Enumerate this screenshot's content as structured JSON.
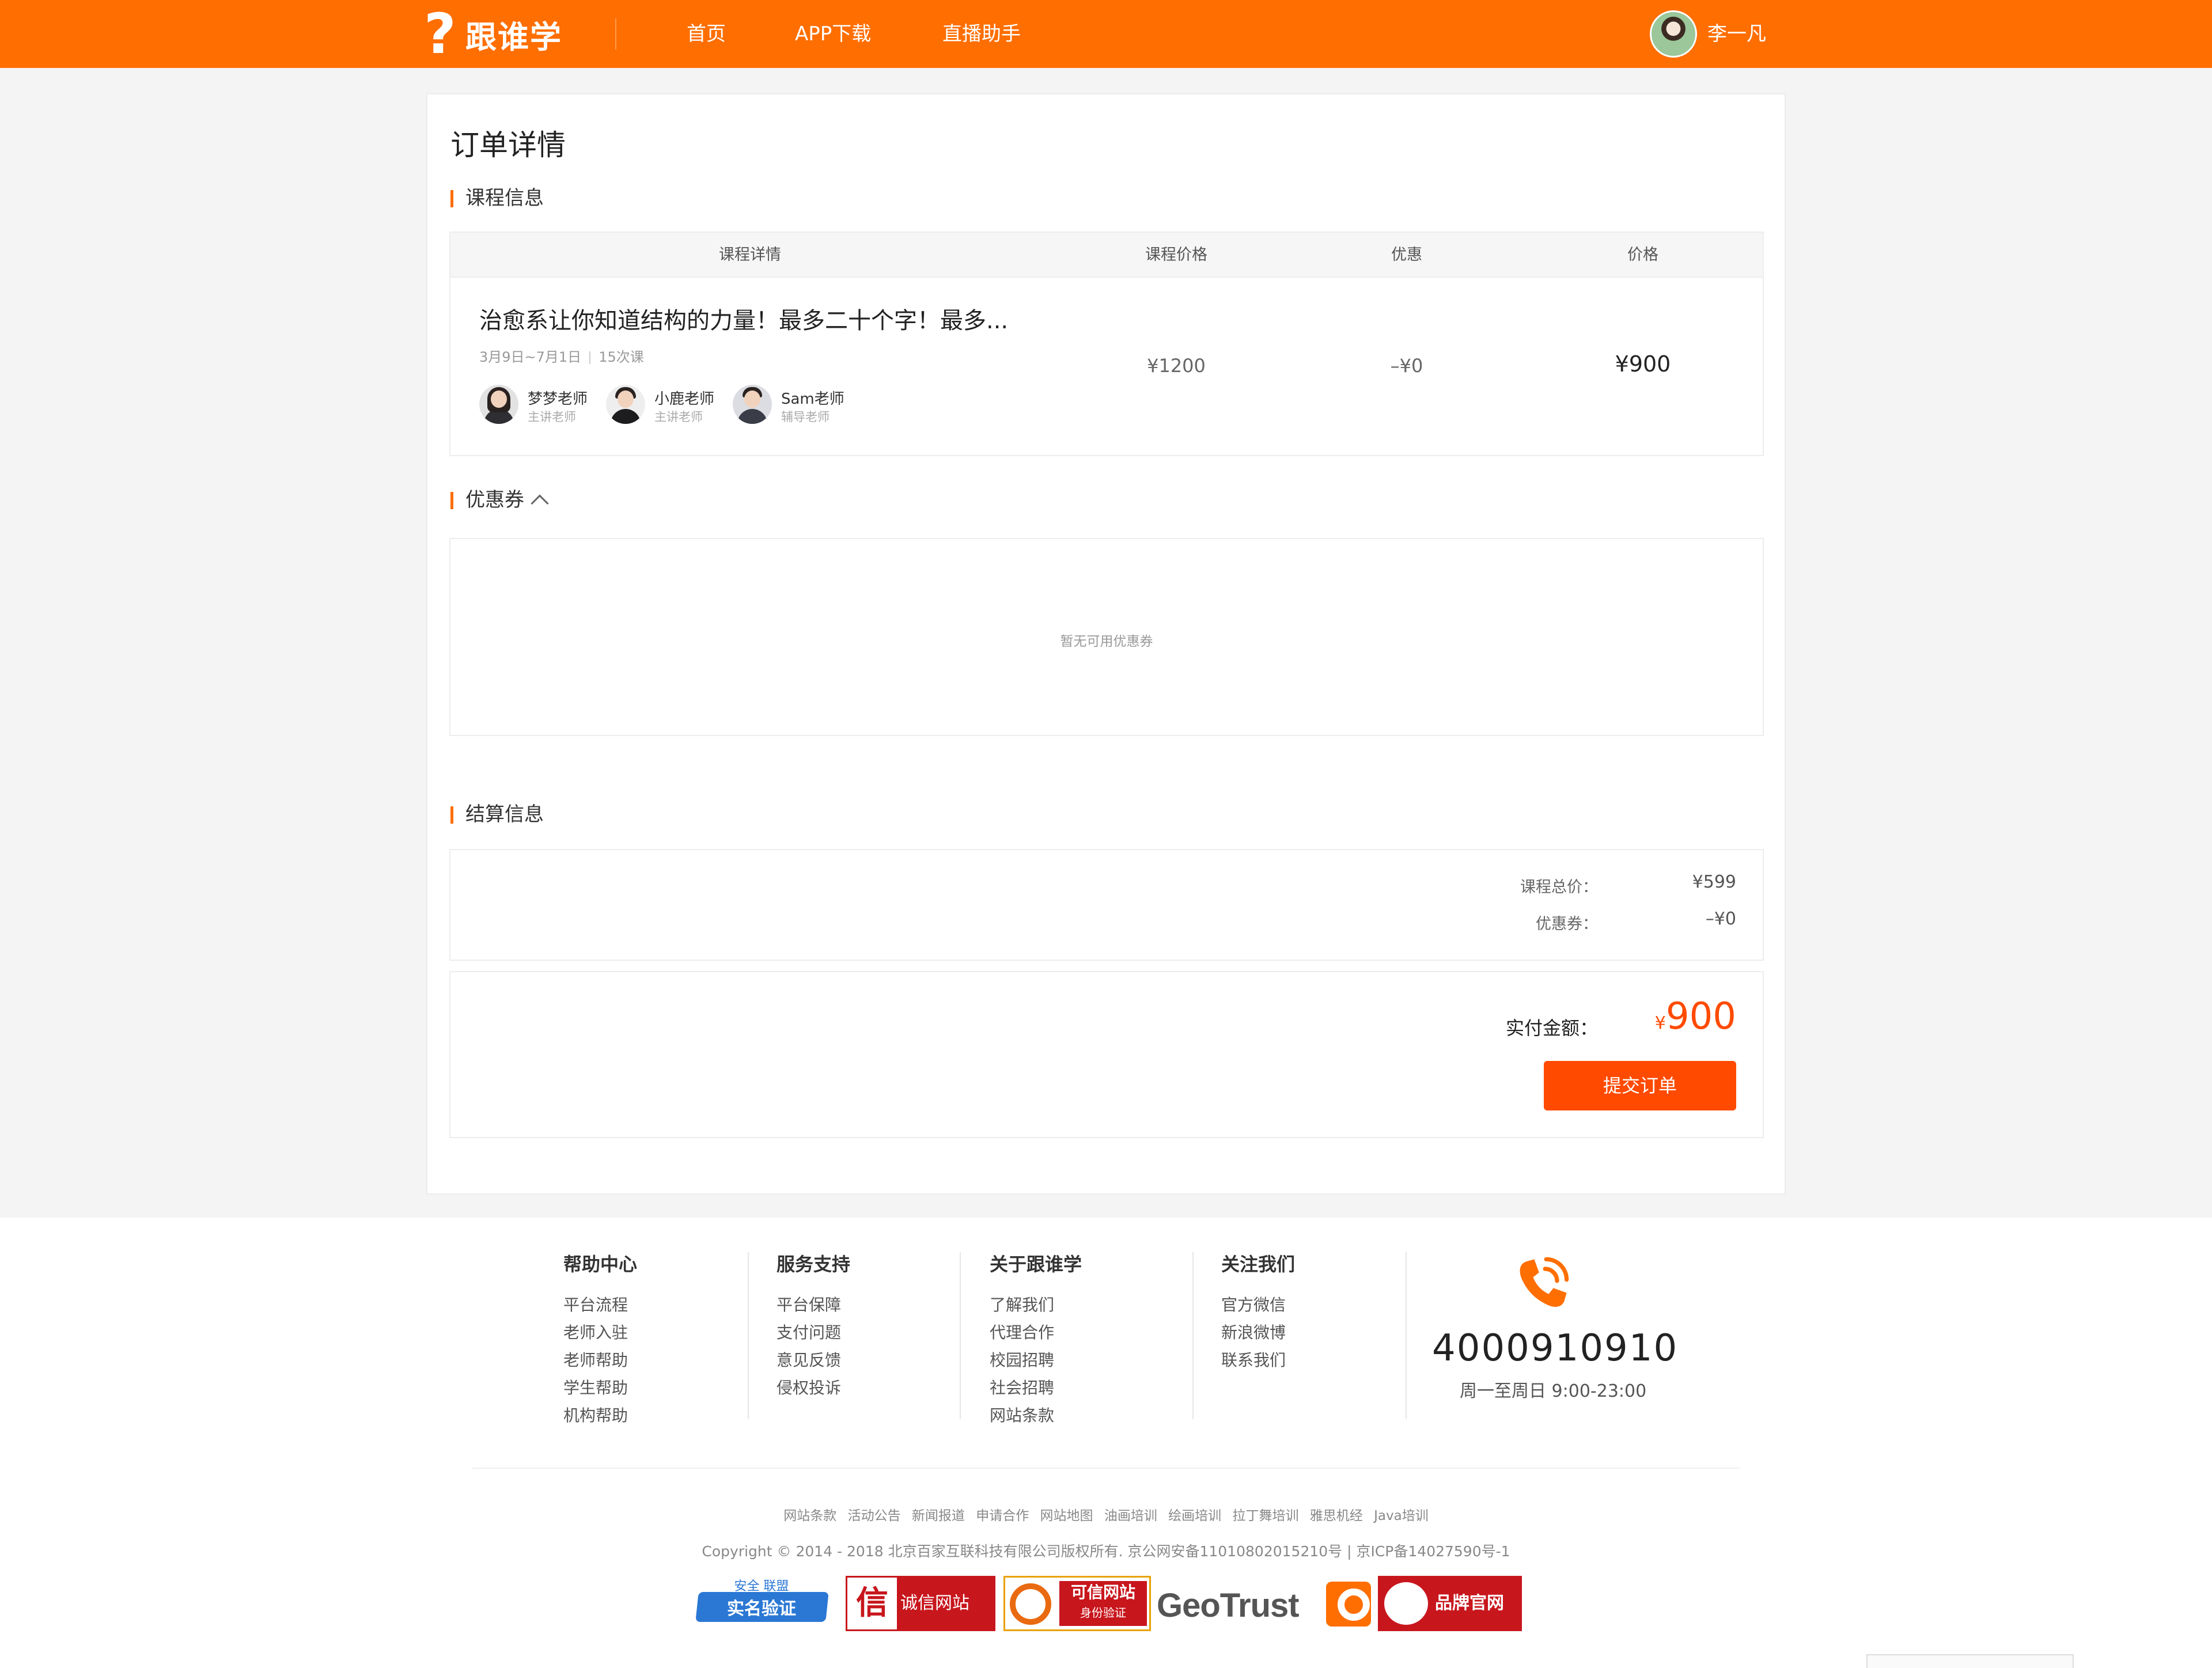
{
  "header": {
    "logo_mark": "?",
    "logo_text": "跟谁学",
    "nav": [
      "首页",
      "APP下载",
      "直播助手"
    ],
    "user_name": "李一凡"
  },
  "page": {
    "title": "订单详情"
  },
  "course_section": {
    "title": "课程信息",
    "columns": [
      "课程详情",
      "课程价格",
      "优惠",
      "价格"
    ],
    "course": {
      "name": "治愈系让你知道结构的力量！最多二十个字！最多...",
      "dates": "3月9日~7月1日",
      "lessons": "15次课",
      "price": "¥1200",
      "discount": "–¥0",
      "final": "¥900"
    },
    "teachers": [
      {
        "name": "梦梦老师",
        "role": "主讲老师"
      },
      {
        "name": "小鹿老师",
        "role": "主讲老师"
      },
      {
        "name": "Sam老师",
        "role": "辅导老师"
      }
    ]
  },
  "coupon_section": {
    "title": "优惠券",
    "empty_text": "暂无可用优惠券"
  },
  "settle_section": {
    "title": "结算信息",
    "rows": [
      {
        "label": "课程总价：",
        "value": "¥599"
      },
      {
        "label": "优惠券：",
        "value": "–¥0"
      }
    ],
    "pay_label": "实付金额：",
    "pay_currency": "¥",
    "pay_amount": "900",
    "submit_label": "提交订单"
  },
  "footer": {
    "columns": [
      {
        "title": "帮助中心",
        "links": [
          "平台流程",
          "老师入驻",
          "老师帮助",
          "学生帮助",
          "机构帮助"
        ]
      },
      {
        "title": "服务支持",
        "links": [
          "平台保障",
          "支付问题",
          "意见反馈",
          "侵权投诉"
        ]
      },
      {
        "title": "关于跟谁学",
        "links": [
          "了解我们",
          "代理合作",
          "校园招聘",
          "社会招聘",
          "网站条款"
        ]
      },
      {
        "title": "关注我们",
        "links": [
          "官方微信",
          "新浪微博",
          "联系我们"
        ]
      }
    ],
    "phone": "4000910910",
    "hours": "周一至周日 9:00-23:00",
    "bottom_links": [
      "网站条款",
      "活动公告",
      "新闻报道",
      "申请合作",
      "网站地图",
      "油画培训",
      "绘画培训",
      "拉丁舞培训",
      "雅思机经",
      "Java培训"
    ],
    "copyright": "Copyright © 2014 - 2018 北京百家互联科技有限公司版权所有. 京公网安备11010802015210号 | 京ICP备14027590号-1",
    "badges": {
      "b1_top": "安全 联盟",
      "b1": "实名验证",
      "b2_seal": "信",
      "b2": "诚信网站",
      "b3_a": "可信网站",
      "b3_b": "身份验证",
      "b4": "GeoTrust",
      "b6": "品牌官网"
    }
  },
  "colors": {
    "brand": "#ff6e00",
    "accent": "#ff4a00"
  }
}
